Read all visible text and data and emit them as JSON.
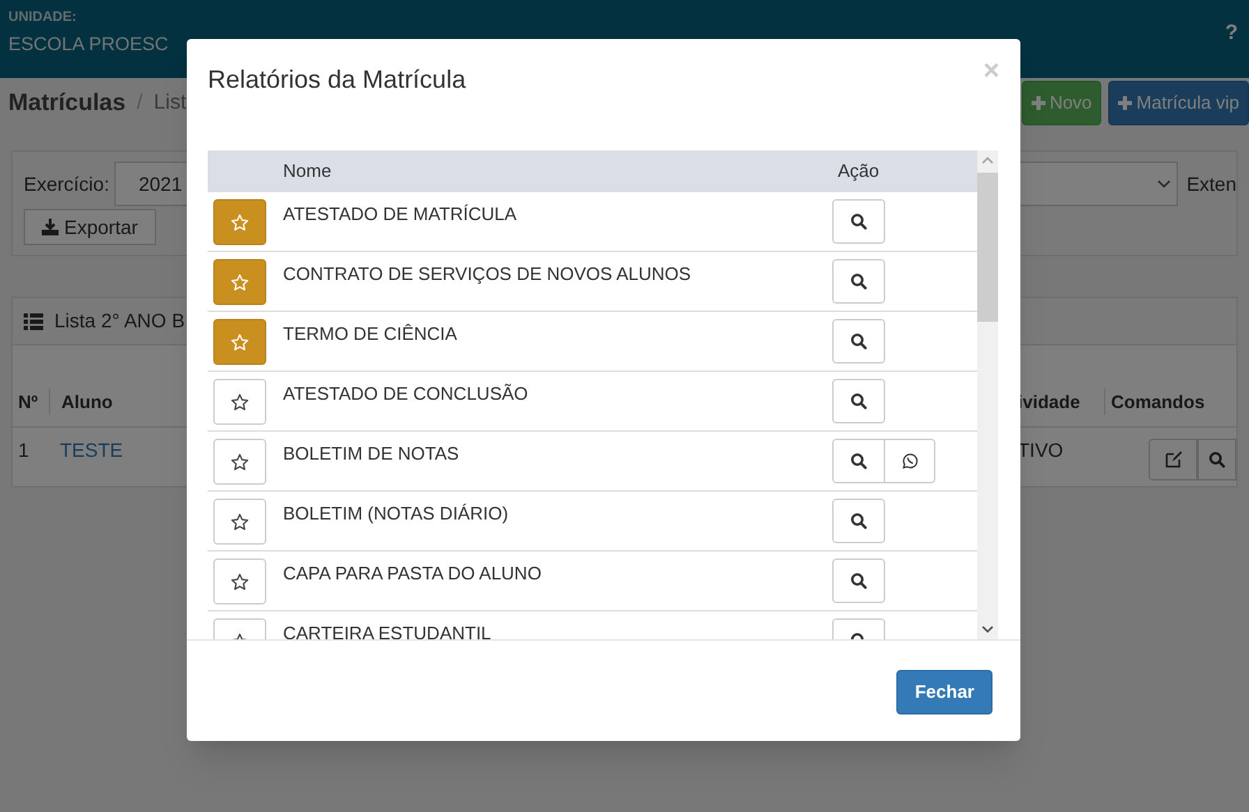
{
  "header": {
    "unit_label": "UNIDADE:",
    "unit_name": "ESCOLA PROESC",
    "help": "?"
  },
  "breadcrumb": {
    "title": "Matrículas",
    "separator": "/",
    "current": "List"
  },
  "actions": [
    {
      "label": "Novo",
      "kind": "success"
    },
    {
      "label": "Matrícula vip",
      "kind": "primary"
    }
  ],
  "filters": {
    "year_label": "Exercício:",
    "year": "2021",
    "extra_label": "Exten",
    "export": "Exportar"
  },
  "list": {
    "title": "Lista 2° ANO B",
    "columns": [
      "Nº",
      "Aluno",
      "ividade",
      "Comandos"
    ],
    "rows": [
      {
        "number": "1",
        "student": "TESTE",
        "status": "TIVO"
      }
    ]
  },
  "modal": {
    "title": "Relatórios da Matrícula",
    "close": "×",
    "columns": [
      "Nome",
      "Ação"
    ],
    "reports": [
      {
        "name": "ATESTADO DE MATRÍCULA",
        "starred": true,
        "whatsapp": false
      },
      {
        "name": "CONTRATO DE SERVIÇOS DE NOVOS ALUNOS",
        "starred": true,
        "whatsapp": false
      },
      {
        "name": "TERMO DE CIÊNCIA",
        "starred": true,
        "whatsapp": false
      },
      {
        "name": "ATESTADO DE CONCLUSÃO",
        "starred": false,
        "whatsapp": false
      },
      {
        "name": "BOLETIM DE NOTAS",
        "starred": false,
        "whatsapp": true
      },
      {
        "name": "BOLETIM (NOTAS DIÁRIO)",
        "starred": false,
        "whatsapp": false
      },
      {
        "name": "CAPA PARA PASTA DO ALUNO",
        "starred": false,
        "whatsapp": false
      },
      {
        "name": "CARTEIRA ESTUDANTIL",
        "starred": false,
        "whatsapp": false
      }
    ],
    "close_button": "Fechar"
  }
}
